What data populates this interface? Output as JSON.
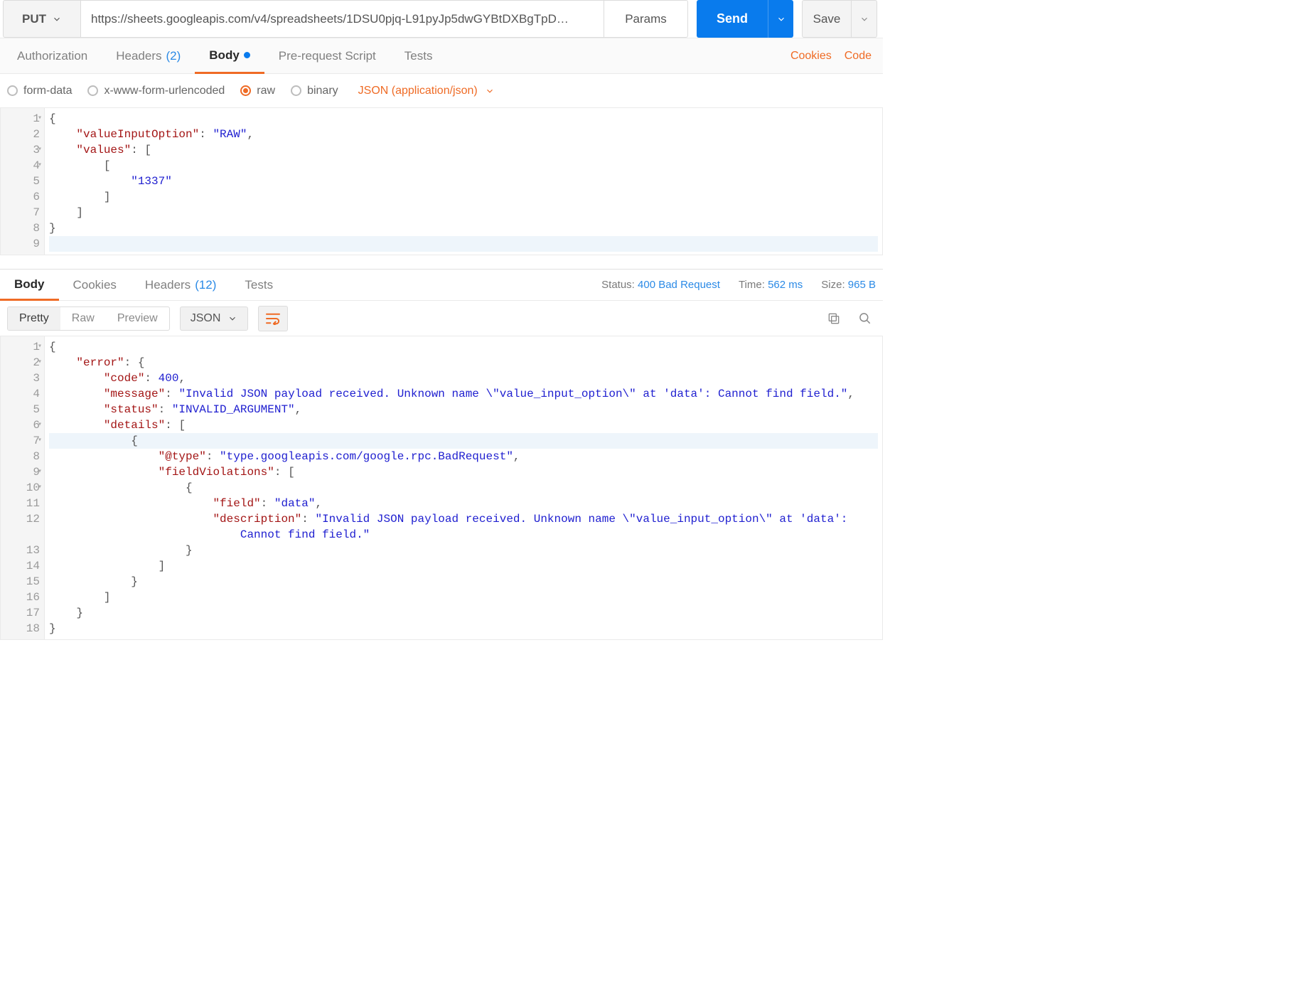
{
  "request": {
    "method": "PUT",
    "url": "https://sheets.googleapis.com/v4/spreadsheets/1DSU0pjq-L91pyJp5dwGYBtDXBgTpD…",
    "params_label": "Params",
    "send_label": "Send",
    "save_label": "Save"
  },
  "req_tabs": {
    "authorization": "Authorization",
    "headers": "Headers",
    "headers_count": "(2)",
    "body": "Body",
    "prerequest": "Pre-request Script",
    "tests": "Tests"
  },
  "links": {
    "cookies": "Cookies",
    "code": "Code"
  },
  "body_types": {
    "formdata": "form-data",
    "urlencoded": "x-www-form-urlencoded",
    "raw": "raw",
    "binary": "binary",
    "content_type": "JSON (application/json)"
  },
  "req_body": [
    {
      "n": "1",
      "fold": true,
      "tokens": [
        [
          "punc",
          "{"
        ]
      ]
    },
    {
      "n": "2",
      "tokens": [
        [
          "ws",
          "    "
        ],
        [
          "key",
          "\"valueInputOption\""
        ],
        [
          "punc",
          ": "
        ],
        [
          "str",
          "\"RAW\""
        ],
        [
          "punc",
          ","
        ]
      ]
    },
    {
      "n": "3",
      "fold": true,
      "tokens": [
        [
          "ws",
          "    "
        ],
        [
          "key",
          "\"values\""
        ],
        [
          "punc",
          ": ["
        ]
      ]
    },
    {
      "n": "4",
      "fold": true,
      "tokens": [
        [
          "ws",
          "        "
        ],
        [
          "punc",
          "["
        ]
      ]
    },
    {
      "n": "5",
      "tokens": [
        [
          "ws",
          "            "
        ],
        [
          "str",
          "\"1337\""
        ]
      ]
    },
    {
      "n": "6",
      "tokens": [
        [
          "ws",
          "        "
        ],
        [
          "punc",
          "]"
        ]
      ]
    },
    {
      "n": "7",
      "tokens": [
        [
          "ws",
          "    "
        ],
        [
          "punc",
          "]"
        ]
      ]
    },
    {
      "n": "8",
      "tokens": [
        [
          "punc",
          "}"
        ]
      ]
    },
    {
      "n": "9",
      "hl": true,
      "tokens": []
    }
  ],
  "resp_tabs": {
    "body": "Body",
    "cookies": "Cookies",
    "headers": "Headers",
    "headers_count": "(12)",
    "tests": "Tests"
  },
  "resp_meta": {
    "status_label": "Status:",
    "status_value": "400 Bad Request",
    "time_label": "Time:",
    "time_value": "562 ms",
    "size_label": "Size:",
    "size_value": "965 B"
  },
  "resp_view": {
    "pretty": "Pretty",
    "raw": "Raw",
    "preview": "Preview",
    "format": "JSON"
  },
  "resp_body": [
    {
      "n": "1",
      "fold": true,
      "tokens": [
        [
          "punc",
          "{"
        ]
      ]
    },
    {
      "n": "2",
      "fold": true,
      "tokens": [
        [
          "ws",
          "    "
        ],
        [
          "key",
          "\"error\""
        ],
        [
          "punc",
          ": {"
        ]
      ]
    },
    {
      "n": "3",
      "tokens": [
        [
          "ws",
          "        "
        ],
        [
          "key",
          "\"code\""
        ],
        [
          "punc",
          ": "
        ],
        [
          "num",
          "400"
        ],
        [
          "punc",
          ","
        ]
      ]
    },
    {
      "n": "4",
      "tokens": [
        [
          "ws",
          "        "
        ],
        [
          "key",
          "\"message\""
        ],
        [
          "punc",
          ": "
        ],
        [
          "str",
          "\"Invalid JSON payload received. Unknown name \\\"value_input_option\\\" at 'data': Cannot find field.\""
        ],
        [
          "punc",
          ","
        ]
      ]
    },
    {
      "n": "5",
      "tokens": [
        [
          "ws",
          "        "
        ],
        [
          "key",
          "\"status\""
        ],
        [
          "punc",
          ": "
        ],
        [
          "str",
          "\"INVALID_ARGUMENT\""
        ],
        [
          "punc",
          ","
        ]
      ]
    },
    {
      "n": "6",
      "fold": true,
      "tokens": [
        [
          "ws",
          "        "
        ],
        [
          "key",
          "\"details\""
        ],
        [
          "punc",
          ": ["
        ]
      ]
    },
    {
      "n": "7",
      "fold": true,
      "hl": true,
      "tokens": [
        [
          "ws",
          "            "
        ],
        [
          "punc",
          "{"
        ]
      ]
    },
    {
      "n": "8",
      "tokens": [
        [
          "ws",
          "                "
        ],
        [
          "key",
          "\"@type\""
        ],
        [
          "punc",
          ": "
        ],
        [
          "str",
          "\"type.googleapis.com/google.rpc.BadRequest\""
        ],
        [
          "punc",
          ","
        ]
      ]
    },
    {
      "n": "9",
      "fold": true,
      "tokens": [
        [
          "ws",
          "                "
        ],
        [
          "key",
          "\"fieldViolations\""
        ],
        [
          "punc",
          ": ["
        ]
      ]
    },
    {
      "n": "10",
      "fold": true,
      "tokens": [
        [
          "ws",
          "                    "
        ],
        [
          "punc",
          "{"
        ]
      ]
    },
    {
      "n": "11",
      "tokens": [
        [
          "ws",
          "                        "
        ],
        [
          "key",
          "\"field\""
        ],
        [
          "punc",
          ": "
        ],
        [
          "str",
          "\"data\""
        ],
        [
          "punc",
          ","
        ]
      ]
    },
    {
      "n": "12",
      "tokens": [
        [
          "ws",
          "                        "
        ],
        [
          "key",
          "\"description\""
        ],
        [
          "punc",
          ": "
        ],
        [
          "str",
          "\"Invalid JSON payload received. Unknown name \\\"value_input_option\\\" at 'data': "
        ]
      ]
    },
    {
      "n": "",
      "tokens": [
        [
          "ws",
          "                            "
        ],
        [
          "str",
          "Cannot find field.\""
        ]
      ]
    },
    {
      "n": "13",
      "tokens": [
        [
          "ws",
          "                    "
        ],
        [
          "punc",
          "}"
        ]
      ]
    },
    {
      "n": "14",
      "tokens": [
        [
          "ws",
          "                "
        ],
        [
          "punc",
          "]"
        ]
      ]
    },
    {
      "n": "15",
      "tokens": [
        [
          "ws",
          "            "
        ],
        [
          "punc",
          "}"
        ]
      ]
    },
    {
      "n": "16",
      "tokens": [
        [
          "ws",
          "        "
        ],
        [
          "punc",
          "]"
        ]
      ]
    },
    {
      "n": "17",
      "tokens": [
        [
          "ws",
          "    "
        ],
        [
          "punc",
          "}"
        ]
      ]
    },
    {
      "n": "18",
      "tokens": [
        [
          "punc",
          "}"
        ]
      ]
    }
  ]
}
